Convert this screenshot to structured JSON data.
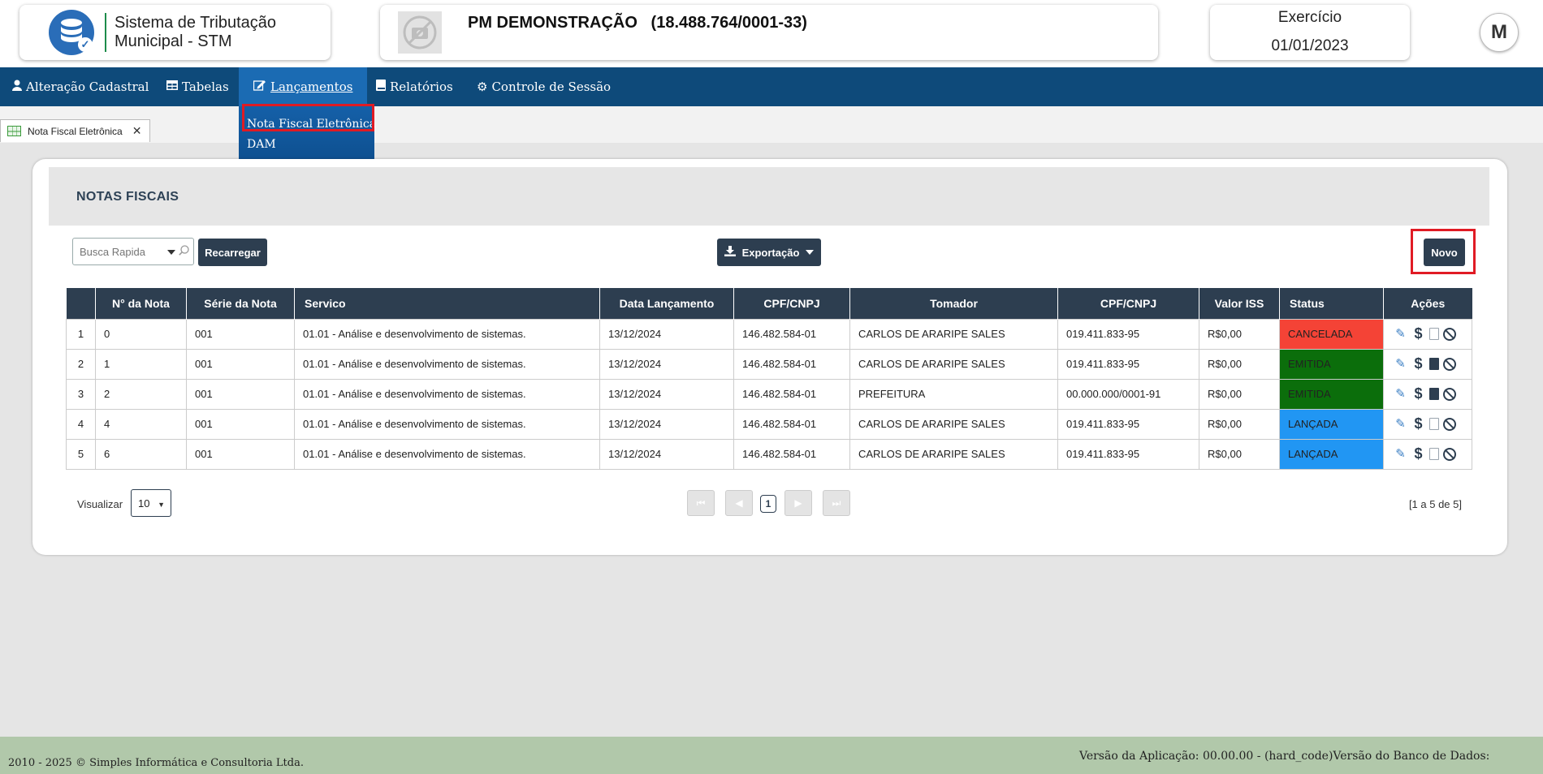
{
  "header": {
    "app_title_line1": "Sistema de Tributação",
    "app_title_line2": "Municipal - STM",
    "org_name": "PM DEMONSTRAÇÃO   (18.488.764/0001-33)",
    "exercise_label": "Exercício",
    "exercise_date": "01/01/2023",
    "user_initial": "M"
  },
  "nav": {
    "items": [
      {
        "label": "Alteração Cadastral",
        "icon": "user-icon"
      },
      {
        "label": "Tabelas",
        "icon": "table-icon"
      },
      {
        "label": "Lançamentos",
        "icon": "edit-icon"
      },
      {
        "label": "Relatórios",
        "icon": "book-icon"
      },
      {
        "label": "Controle de Sessão",
        "icon": "gear-icon"
      }
    ],
    "dropdown": [
      "Nota Fiscal Eletrônica",
      "DAM"
    ]
  },
  "tab": {
    "label": "Nota Fiscal Eletrônica"
  },
  "panel": {
    "title": "NOTAS FISCAIS",
    "search_placeholder": "Busca Rapida",
    "reload_label": "Recarregar",
    "export_label": "Exportação",
    "new_label": "Novo"
  },
  "table": {
    "headers": [
      "",
      "N° da Nota",
      "Série da Nota",
      "Servico",
      "Data Lançamento",
      "CPF/CNPJ",
      "Tomador",
      "CPF/CNPJ",
      "Valor ISS",
      "Status",
      "Ações"
    ],
    "rows": [
      {
        "idx": "1",
        "nota": "0",
        "serie": "001",
        "servico": "01.01 - Análise e desenvolvimento de sistemas.",
        "data": "13/12/2024",
        "cpf": "146.482.584-01",
        "tomador": "CARLOS DE ARARIPE SALES",
        "cpf_tomador": "019.411.833-95",
        "valor": "R$0,00",
        "status": "CANCELADA",
        "status_color": "#f44336"
      },
      {
        "idx": "2",
        "nota": "1",
        "serie": "001",
        "servico": "01.01 - Análise e desenvolvimento de sistemas.",
        "data": "13/12/2024",
        "cpf": "146.482.584-01",
        "tomador": "CARLOS DE ARARIPE SALES",
        "cpf_tomador": "019.411.833-95",
        "valor": "R$0,00",
        "status": "EMITIDA",
        "status_color": "#0b6e0b"
      },
      {
        "idx": "3",
        "nota": "2",
        "serie": "001",
        "servico": "01.01 - Análise e desenvolvimento de sistemas.",
        "data": "13/12/2024",
        "cpf": "146.482.584-01",
        "tomador": "PREFEITURA",
        "cpf_tomador": "00.000.000/0001-91",
        "valor": "R$0,00",
        "status": "EMITIDA",
        "status_color": "#0b6e0b"
      },
      {
        "idx": "4",
        "nota": "4",
        "serie": "001",
        "servico": "01.01 - Análise e desenvolvimento de sistemas.",
        "data": "13/12/2024",
        "cpf": "146.482.584-01",
        "tomador": "CARLOS DE ARARIPE SALES",
        "cpf_tomador": "019.411.833-95",
        "valor": "R$0,00",
        "status": "LANÇADA",
        "status_color": "#2196f3"
      },
      {
        "idx": "5",
        "nota": "6",
        "serie": "001",
        "servico": "01.01 - Análise e desenvolvimento de sistemas.",
        "data": "13/12/2024",
        "cpf": "146.482.584-01",
        "tomador": "CARLOS DE ARARIPE SALES",
        "cpf_tomador": "019.411.833-95",
        "valor": "R$0,00",
        "status": "LANÇADA",
        "status_color": "#2196f3"
      }
    ]
  },
  "pager": {
    "view_label": "Visualizar",
    "page_size": "10",
    "current_page": "1",
    "range": "[1 a 5 de 5]"
  },
  "footer": {
    "left": "2010 - 2025 © Simples Informática e Consultoria Ltda.",
    "right": "Versão da Aplicação: 00.00.00 - (hard_code)Versão do Banco de Dados:"
  },
  "colors": {
    "nav_bg": "#0e4a7a",
    "header_dark": "#2d3e50",
    "highlight": "#e01b24",
    "footer_bg": "#b1c8aa"
  }
}
